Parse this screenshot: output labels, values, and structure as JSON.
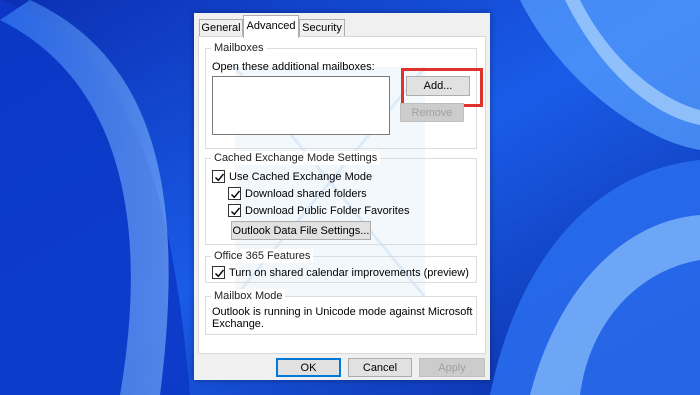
{
  "tabs": [
    {
      "label": "General",
      "active": false
    },
    {
      "label": "Advanced",
      "active": true
    },
    {
      "label": "Security",
      "active": false
    }
  ],
  "mailboxes": {
    "group_title": "Mailboxes",
    "open_label": "Open these additional mailboxes:",
    "add_button": "Add...",
    "remove_button": "Remove"
  },
  "cached": {
    "group_title": "Cached Exchange Mode Settings",
    "use_cached": {
      "label": "Use Cached Exchange Mode",
      "checked": true
    },
    "download_shared": {
      "label": "Download shared folders",
      "checked": true
    },
    "download_public": {
      "label": "Download Public Folder Favorites",
      "checked": true
    },
    "data_file_button": "Outlook Data File Settings..."
  },
  "office365": {
    "group_title": "Office 365 Features",
    "shared_calendar": {
      "label": "Turn on shared calendar improvements (preview)",
      "checked": true
    }
  },
  "mailbox_mode": {
    "group_title": "Mailbox Mode",
    "text": "Outlook is running in Unicode mode against Microsoft Exchange."
  },
  "footer": {
    "ok": "OK",
    "cancel": "Cancel",
    "apply": "Apply"
  },
  "colors": {
    "wallpaper": "#1846d6",
    "highlight": "#e0322d",
    "default_button_border": "#0078d7"
  }
}
